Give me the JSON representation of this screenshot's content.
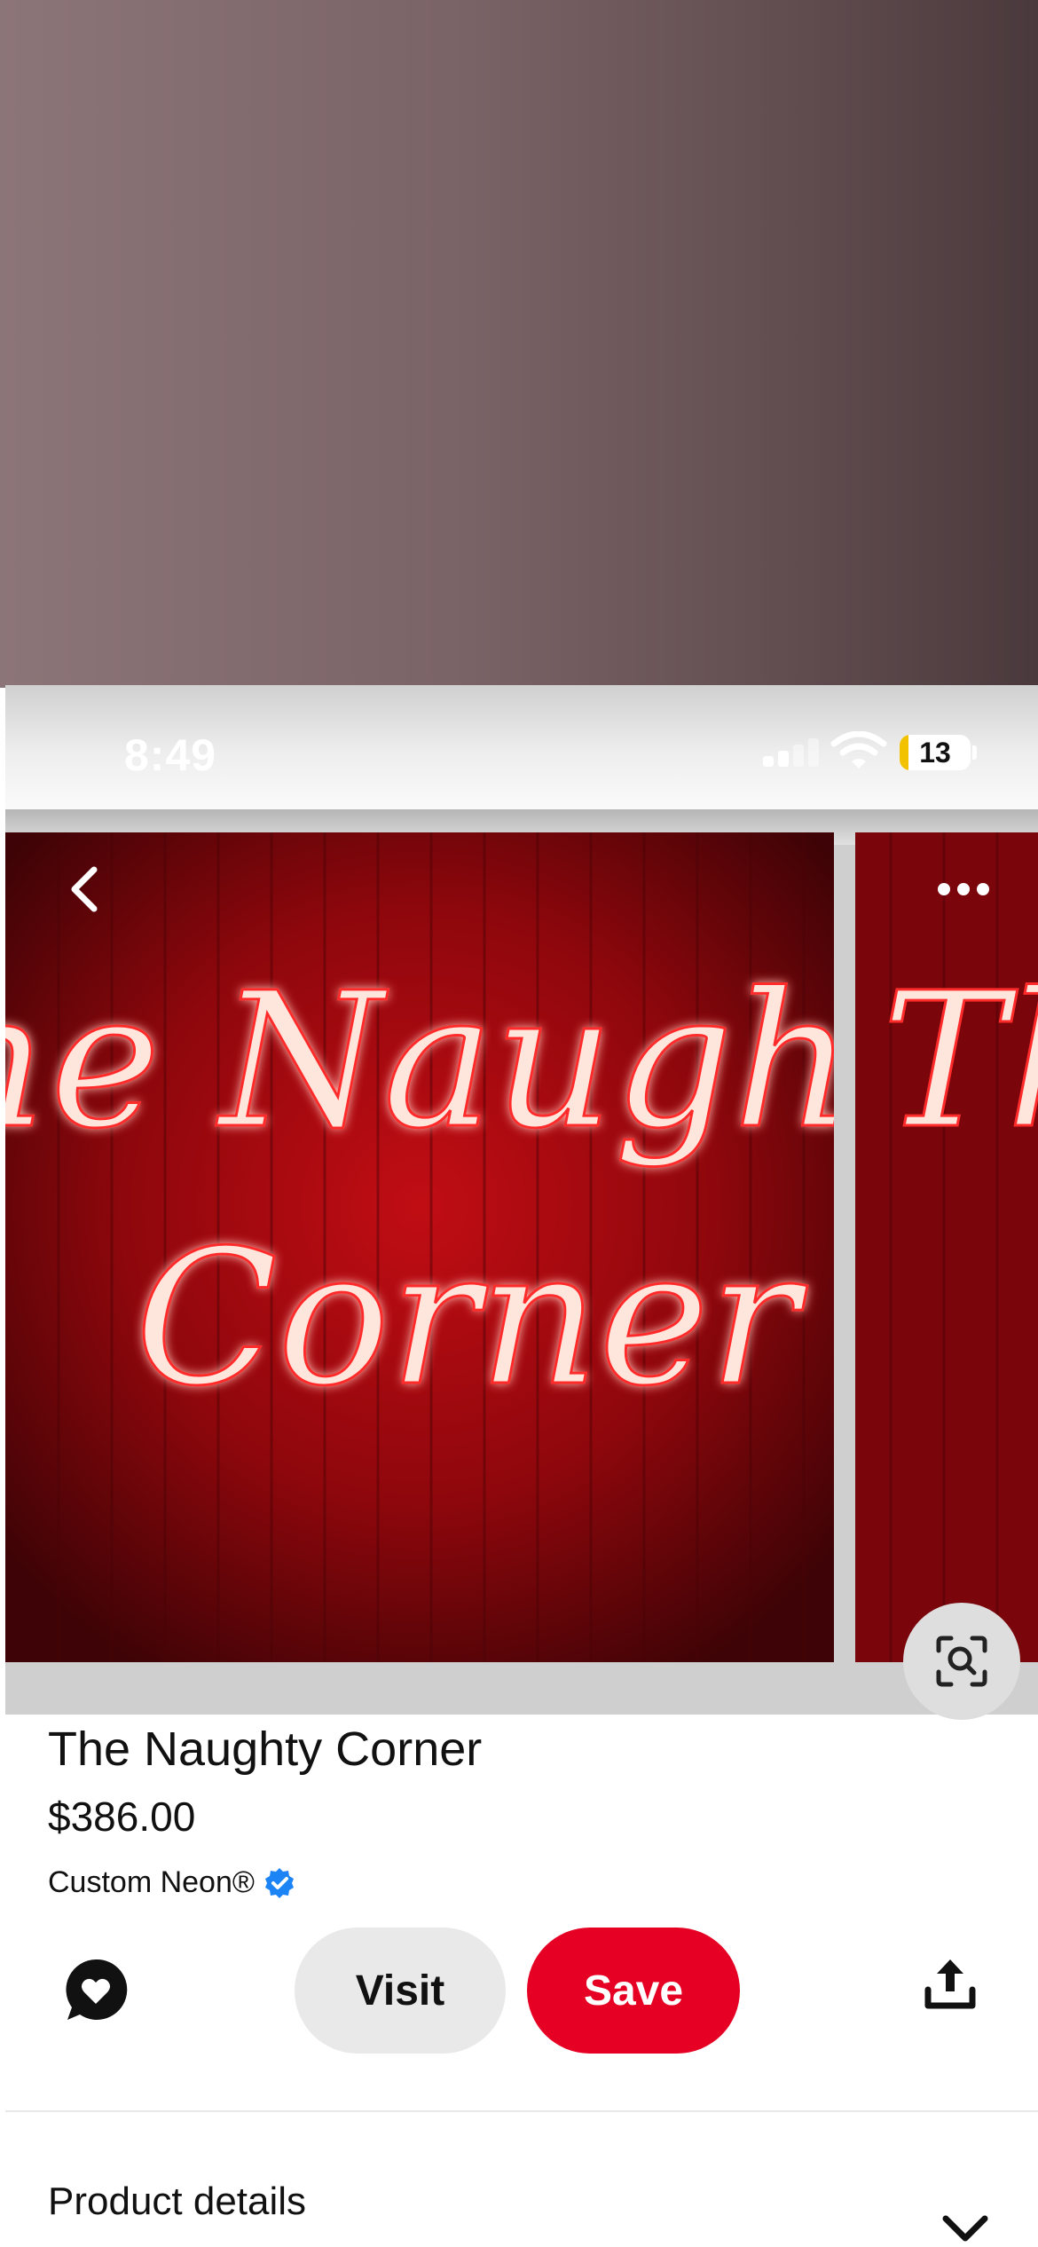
{
  "status_bar": {
    "time": "8:49",
    "battery_level": "13",
    "battery_color": "#f2c200"
  },
  "nav": {
    "back_icon": "chevron-left-icon",
    "more_icon": "ellipsis-icon"
  },
  "image": {
    "sign_line_1": "The Naughty",
    "sign_line_2": "Corner"
  },
  "product": {
    "title": "The Naughty Corner",
    "price": "$386.00",
    "merchant": "Custom Neon®",
    "verified_icon": "verified-check-icon"
  },
  "actions": {
    "visit_label": "Visit",
    "save_label": "Save",
    "save_color": "#e60023",
    "comment_icon": "comment-heart-icon",
    "share_icon": "share-icon",
    "visual_search_icon": "lens-search-icon"
  },
  "details": {
    "title": "Product details",
    "toggle_icon": "chevron-down-icon"
  }
}
